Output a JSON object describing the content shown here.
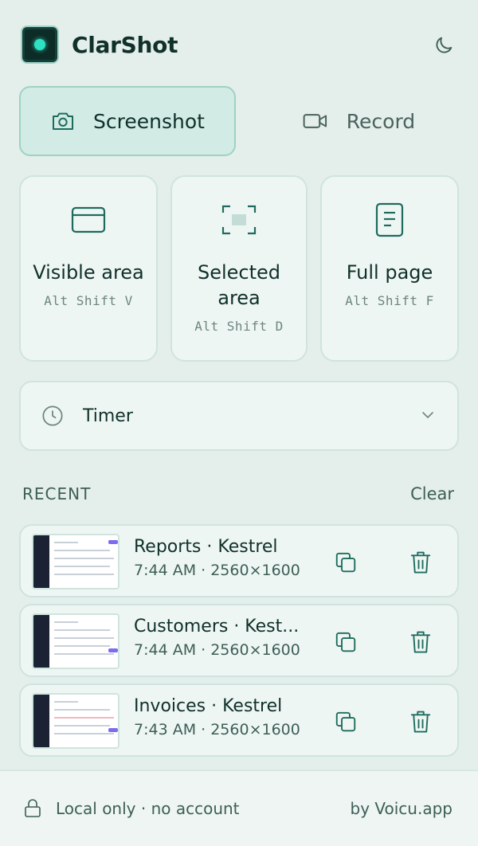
{
  "app": {
    "title": "ClarShot"
  },
  "modes": {
    "screenshot_label": "Screenshot",
    "record_label": "Record",
    "active": "Screenshot"
  },
  "capture_options": [
    {
      "label": "Visible area",
      "shortcut": "Alt Shift V",
      "icon": "window-icon"
    },
    {
      "label": "Selected area",
      "shortcut": "Alt Shift D",
      "icon": "selection-icon"
    },
    {
      "label": "Full page",
      "shortcut": "Alt Shift F",
      "icon": "document-icon"
    }
  ],
  "timer": {
    "label": "Timer"
  },
  "recent": {
    "title": "RECENT",
    "clear_label": "Clear",
    "items": [
      {
        "title": "Reports · Kestrel",
        "meta": "7:44 AM · 2560×1600"
      },
      {
        "title": "Customers · Kest...",
        "meta": "7:44 AM · 2560×1600"
      },
      {
        "title": "Invoices · Kestrel",
        "meta": "7:43 AM · 2560×1600"
      }
    ]
  },
  "footer": {
    "privacy": "Local only · no account",
    "credit": "by Voicu.app"
  },
  "colors": {
    "background": "#e4eeea",
    "accent": "#1e6b5e",
    "active_tab": "#d2ece5",
    "card": "#eef6f3"
  }
}
